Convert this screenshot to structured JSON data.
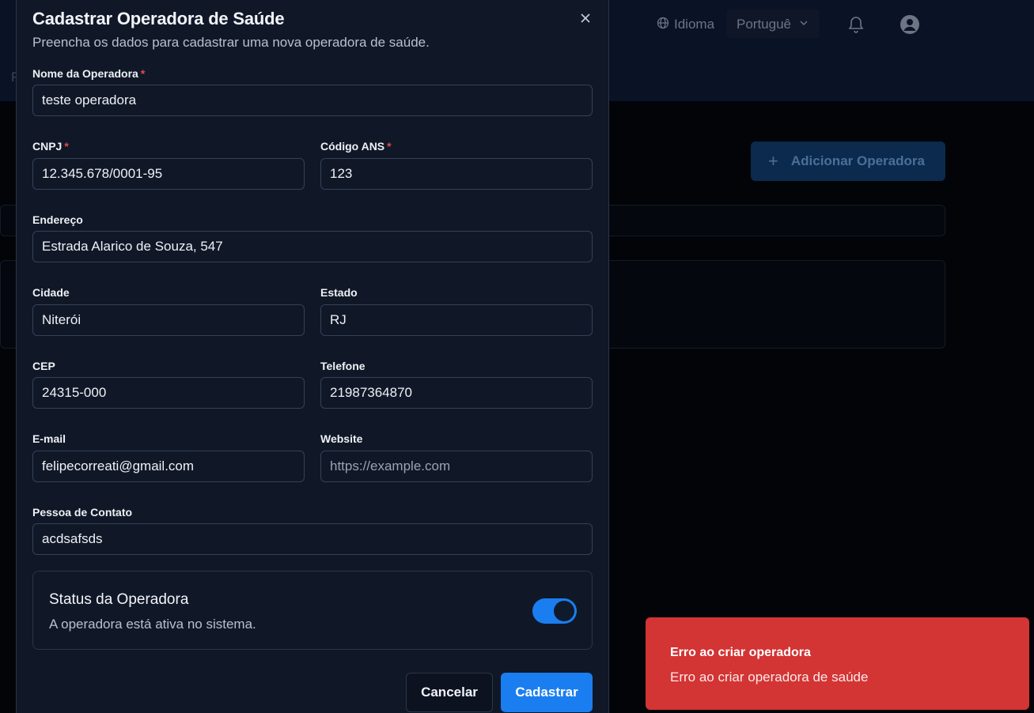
{
  "background": {
    "language_label": "Idioma",
    "language_value": "Portuguê",
    "nav_letter": "F",
    "add_button_label": "Adicionar Operadora"
  },
  "modal": {
    "title": "Cadastrar Operadora de Saúde",
    "subtitle": "Preencha os dados para cadastrar uma nova operadora de saúde.",
    "fields": {
      "nome": {
        "label": "Nome da Operadora",
        "required_mark": "*",
        "value": "teste operadora"
      },
      "cnpj": {
        "label": "CNPJ",
        "required_mark": "*",
        "value": "12.345.678/0001-95"
      },
      "codigo_ans": {
        "label": "Código ANS",
        "required_mark": "*",
        "value": "123"
      },
      "endereco": {
        "label": "Endereço",
        "value": "Estrada Alarico de Souza, 547"
      },
      "cidade": {
        "label": "Cidade",
        "value": "Niterói"
      },
      "estado": {
        "label": "Estado",
        "value": "RJ"
      },
      "cep": {
        "label": "CEP",
        "value": "24315-000"
      },
      "telefone": {
        "label": "Telefone",
        "value": "21987364870"
      },
      "email": {
        "label": "E-mail",
        "value": "felipecorreati@gmail.com"
      },
      "website": {
        "label": "Website",
        "value": "",
        "placeholder": "https://example.com"
      },
      "contato": {
        "label": "Pessoa de Contato",
        "value": "acdsafsds"
      }
    },
    "status": {
      "title": "Status da Operadora",
      "description": "A operadora está ativa no sistema.",
      "active": true
    },
    "buttons": {
      "cancel": "Cancelar",
      "submit": "Cadastrar"
    }
  },
  "toast": {
    "title": "Erro ao criar operadora",
    "description": "Erro ao criar operadora de saúde",
    "color": "#d33434"
  },
  "colors": {
    "accent": "#1a7ef0",
    "required": "#e14b4b"
  }
}
